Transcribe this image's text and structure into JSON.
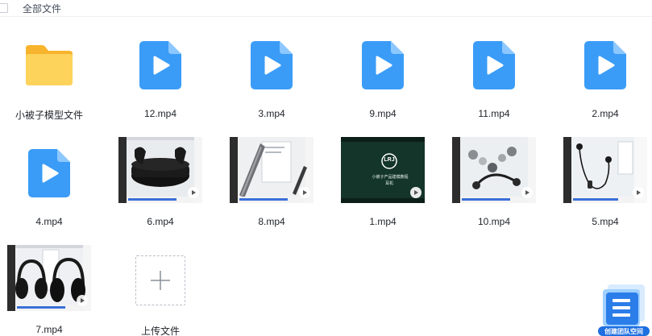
{
  "breadcrumb": {
    "label": "全部文件"
  },
  "colors": {
    "video_icon": "#3a9cf7",
    "folder": "#fbc53a",
    "widget": "#2b7de9"
  },
  "row1": [
    {
      "name": "小被子模型文件",
      "type": "folder"
    },
    {
      "name": "12.mp4",
      "type": "video"
    },
    {
      "name": "3.mp4",
      "type": "video"
    },
    {
      "name": "9.mp4",
      "type": "video"
    },
    {
      "name": "11.mp4",
      "type": "video"
    },
    {
      "name": "2.mp4",
      "type": "video"
    }
  ],
  "row2": [
    {
      "name": "4.mp4",
      "type": "video"
    },
    {
      "name": "6.mp4",
      "type": "video-thumbnail"
    },
    {
      "name": "8.mp4",
      "type": "video-thumbnail"
    },
    {
      "name": "1.mp4",
      "type": "video-thumbnail"
    },
    {
      "name": "10.mp4",
      "type": "video-thumbnail"
    },
    {
      "name": "5.mp4",
      "type": "video-thumbnail"
    }
  ],
  "row3": [
    {
      "name": "7.mp4",
      "type": "video-thumbnail"
    },
    {
      "name": "上传文件",
      "type": "upload"
    }
  ],
  "thumb_1": {
    "logo": "LRJ",
    "caption": "小被子产品建模教程",
    "subcaption": "耳机"
  },
  "widget_label": "创建团队空间"
}
